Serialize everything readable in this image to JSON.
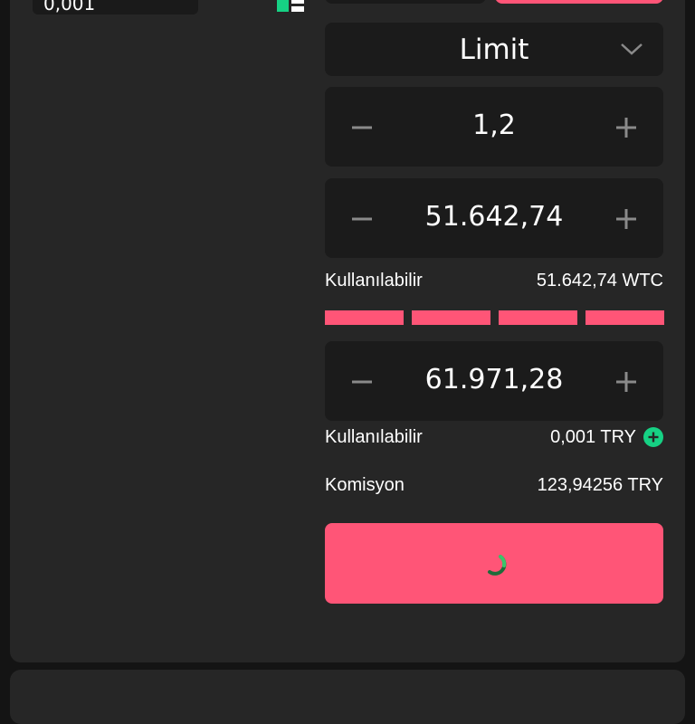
{
  "order_book": {
    "quantity_select": {
      "value": "0,001"
    }
  },
  "order_form": {
    "order_type": "Limit",
    "price_stepper": {
      "value": "1,2"
    },
    "amount_stepper": {
      "value": "51.642,74"
    },
    "available_base": {
      "label": "Kullanılabilir",
      "value": "51.642,74 WTC"
    },
    "percent_bars": {
      "count": 4,
      "color": "#ff5577"
    },
    "total_stepper": {
      "value": "61.971,28"
    },
    "available_quote": {
      "label": "Kullanılabilir",
      "value": "0,001 TRY"
    },
    "commission": {
      "label": "Komisyon",
      "value": "123,94256 TRY"
    },
    "submit": {
      "state": "loading",
      "icon": "spinner-icon"
    }
  },
  "colors": {
    "background": "#141414",
    "panel": "#262626",
    "field": "#1b1b1b",
    "accent_sell": "#ff5577",
    "accent_green": "#16d184",
    "icon_gray": "#8a8a8a"
  }
}
